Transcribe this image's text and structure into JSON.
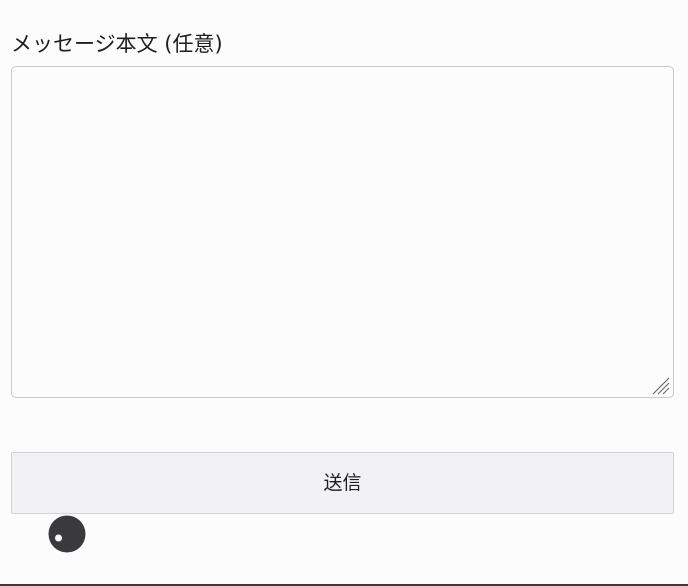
{
  "form": {
    "message_label": "メッセージ本文 (任意)",
    "message_value": "",
    "submit_label": "送信"
  },
  "icons": {
    "textarea_resize": "resize-grip-icon",
    "floating_toggle": "eye-toggle-icon"
  },
  "colors": {
    "background": "#fdfcfd",
    "border": "#c9c9c9",
    "button_background": "#f2f2f5",
    "icon": "#3a3a3c"
  }
}
